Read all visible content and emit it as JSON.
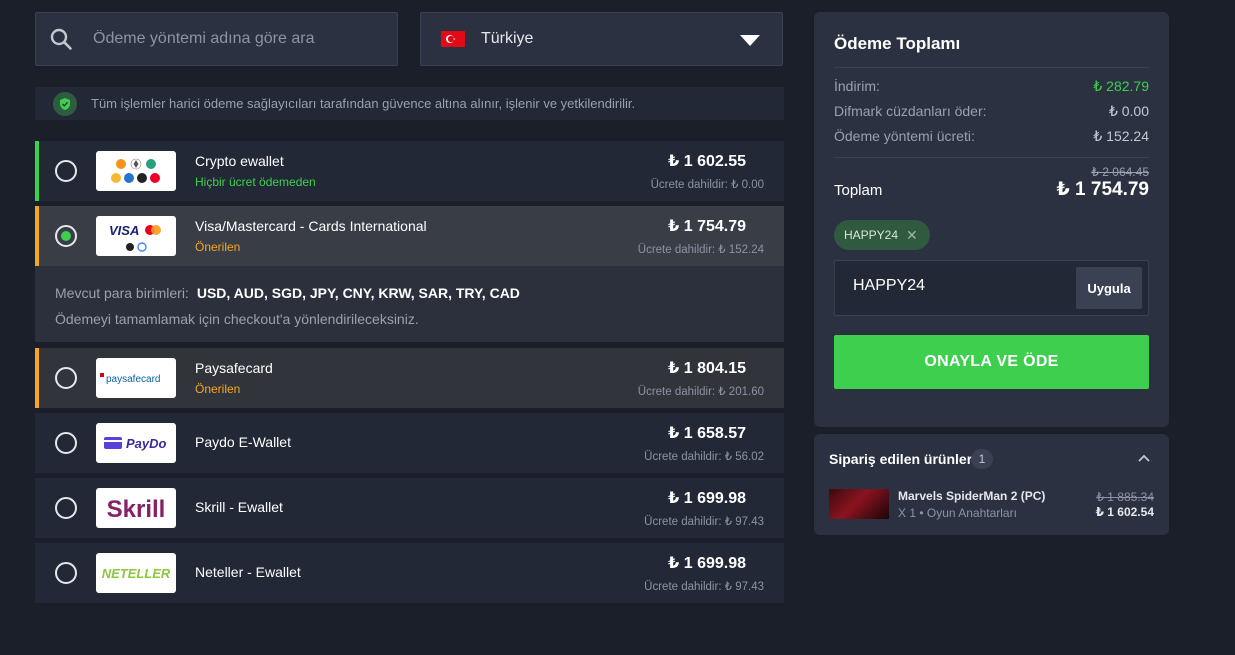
{
  "search": {
    "placeholder": "Ödeme yöntemi adına göre ara"
  },
  "country": {
    "label": "Türkiye"
  },
  "notice": {
    "text": "Tüm işlemler harici ödeme sağlayıcıları tarafından güvence altına alınır, işlenir ve yetkilendirilir."
  },
  "payments": [
    {
      "name": "Crypto ewallet",
      "sub": "Hiçbir ücret ödemeden",
      "price": "₺ 1 602.55",
      "fee": "Ücrete dahildir: ₺ 0.00"
    },
    {
      "name": "Visa/Mastercard - Cards International",
      "sub": "Önerilen",
      "price": "₺ 1 754.79",
      "fee": "Ücrete dahildir: ₺ 152.24"
    },
    {
      "name": "Paysafecard",
      "sub": "Önerilen",
      "price": "₺ 1 804.15",
      "fee": "Ücrete dahildir: ₺ 201.60"
    },
    {
      "name": "Paydo E-Wallet",
      "sub": "",
      "price": "₺ 1 658.57",
      "fee": "Ücrete dahildir: ₺ 56.02"
    },
    {
      "name": "Skrill - Ewallet",
      "sub": "",
      "price": "₺ 1 699.98",
      "fee": "Ücrete dahildir: ₺ 97.43"
    },
    {
      "name": "Neteller - Ewallet",
      "sub": "",
      "price": "₺ 1 699.98",
      "fee": "Ücrete dahildir: ₺ 97.43"
    }
  ],
  "logos": {
    "visa": "VISA",
    "paysafe": "paysafecard",
    "paydo": "PayDo",
    "skrill": "Skrill",
    "neteller": "NETELLER"
  },
  "expanded": {
    "currencies_label": "Mevcut para birimleri:",
    "currencies": "USD, AUD, SGD, JPY, CNY, KRW, SAR, TRY, CAD",
    "redirect": "Ödemeyi tamamlamak için checkout'a yönlendirileceksiniz."
  },
  "summary": {
    "title": "Ödeme Toplamı",
    "discount_label": "İndirim:",
    "discount_value": "₺ 282.79",
    "wallet_label": "Difmark cüzdanları öder:",
    "wallet_value": "₺ 0.00",
    "fee_label": "Ödeme yöntemi ücreti:",
    "fee_value": "₺ 152.24",
    "old_total": "₺ 2 064.45",
    "total_label": "Toplam",
    "total_value": "₺ 1 754.79",
    "coupon_chip": "HAPPY24",
    "coupon_input": "HAPPY24",
    "apply_label": "Uygula",
    "confirm_label": "ONAYLA VE ÖDE"
  },
  "orders": {
    "title": "Sipariş edilen ürünler",
    "count": "1",
    "product_name": "Marvels SpiderMan 2 (PC)",
    "product_meta": "X 1 • Oyun Anahtarları",
    "old_price": "₺ 1 885.34",
    "price": "₺ 1 602.54"
  },
  "colors": {
    "accent_green": "#3ecf4f",
    "accent_orange": "#f5a623",
    "background": "#1b1f29",
    "panel": "#2b3140"
  }
}
